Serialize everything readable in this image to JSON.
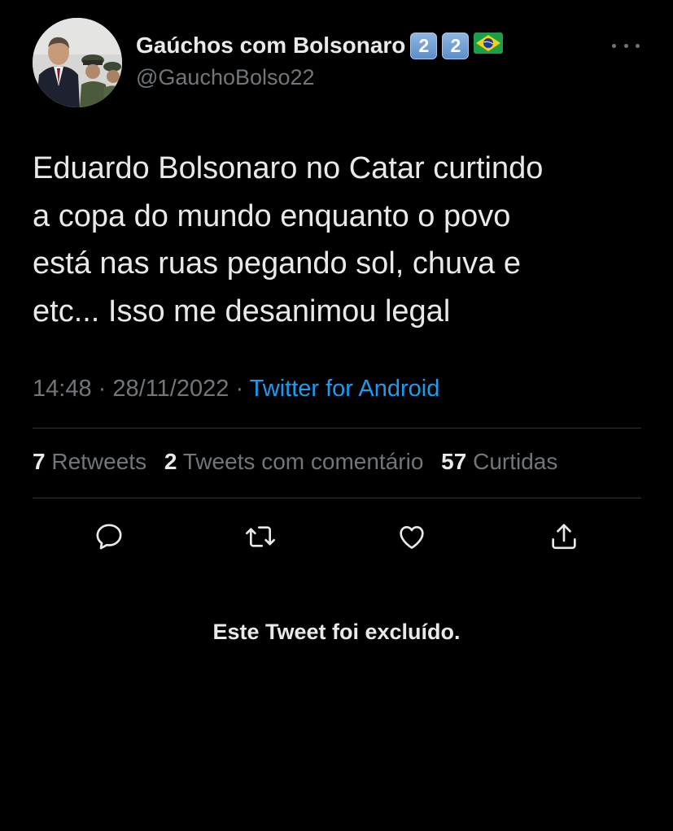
{
  "author": {
    "display_name": "Gaúchos com Bolsonaro",
    "emoji_keys": [
      "2",
      "2"
    ],
    "flag_icon": "brazil-flag-icon",
    "handle": "@GauchoBolso22"
  },
  "tweet": {
    "text_lines": [
      "Eduardo Bolsonaro no Catar curtindo",
      "a copa do mundo enquanto o povo",
      "está nas ruas pegando sol, chuva e",
      "etc... Isso me desanimou legal"
    ],
    "time": "14:48",
    "separator": "·",
    "date": "28/11/2022",
    "source": "Twitter for Android"
  },
  "stats": {
    "retweets_count": "7",
    "retweets_label": "Retweets",
    "quotes_count": "2",
    "quotes_label": "Tweets com comentário",
    "likes_count": "57",
    "likes_label": "Curtidas"
  },
  "actions": [
    "reply-icon",
    "retweet-icon",
    "like-icon",
    "share-icon"
  ],
  "deleted_notice": "Este Tweet foi excluído.",
  "colors": {
    "background": "#000000",
    "text_primary": "#e7e9ea",
    "text_secondary": "#71767b",
    "link": "#1d9bf0",
    "divider": "#2f3336"
  }
}
